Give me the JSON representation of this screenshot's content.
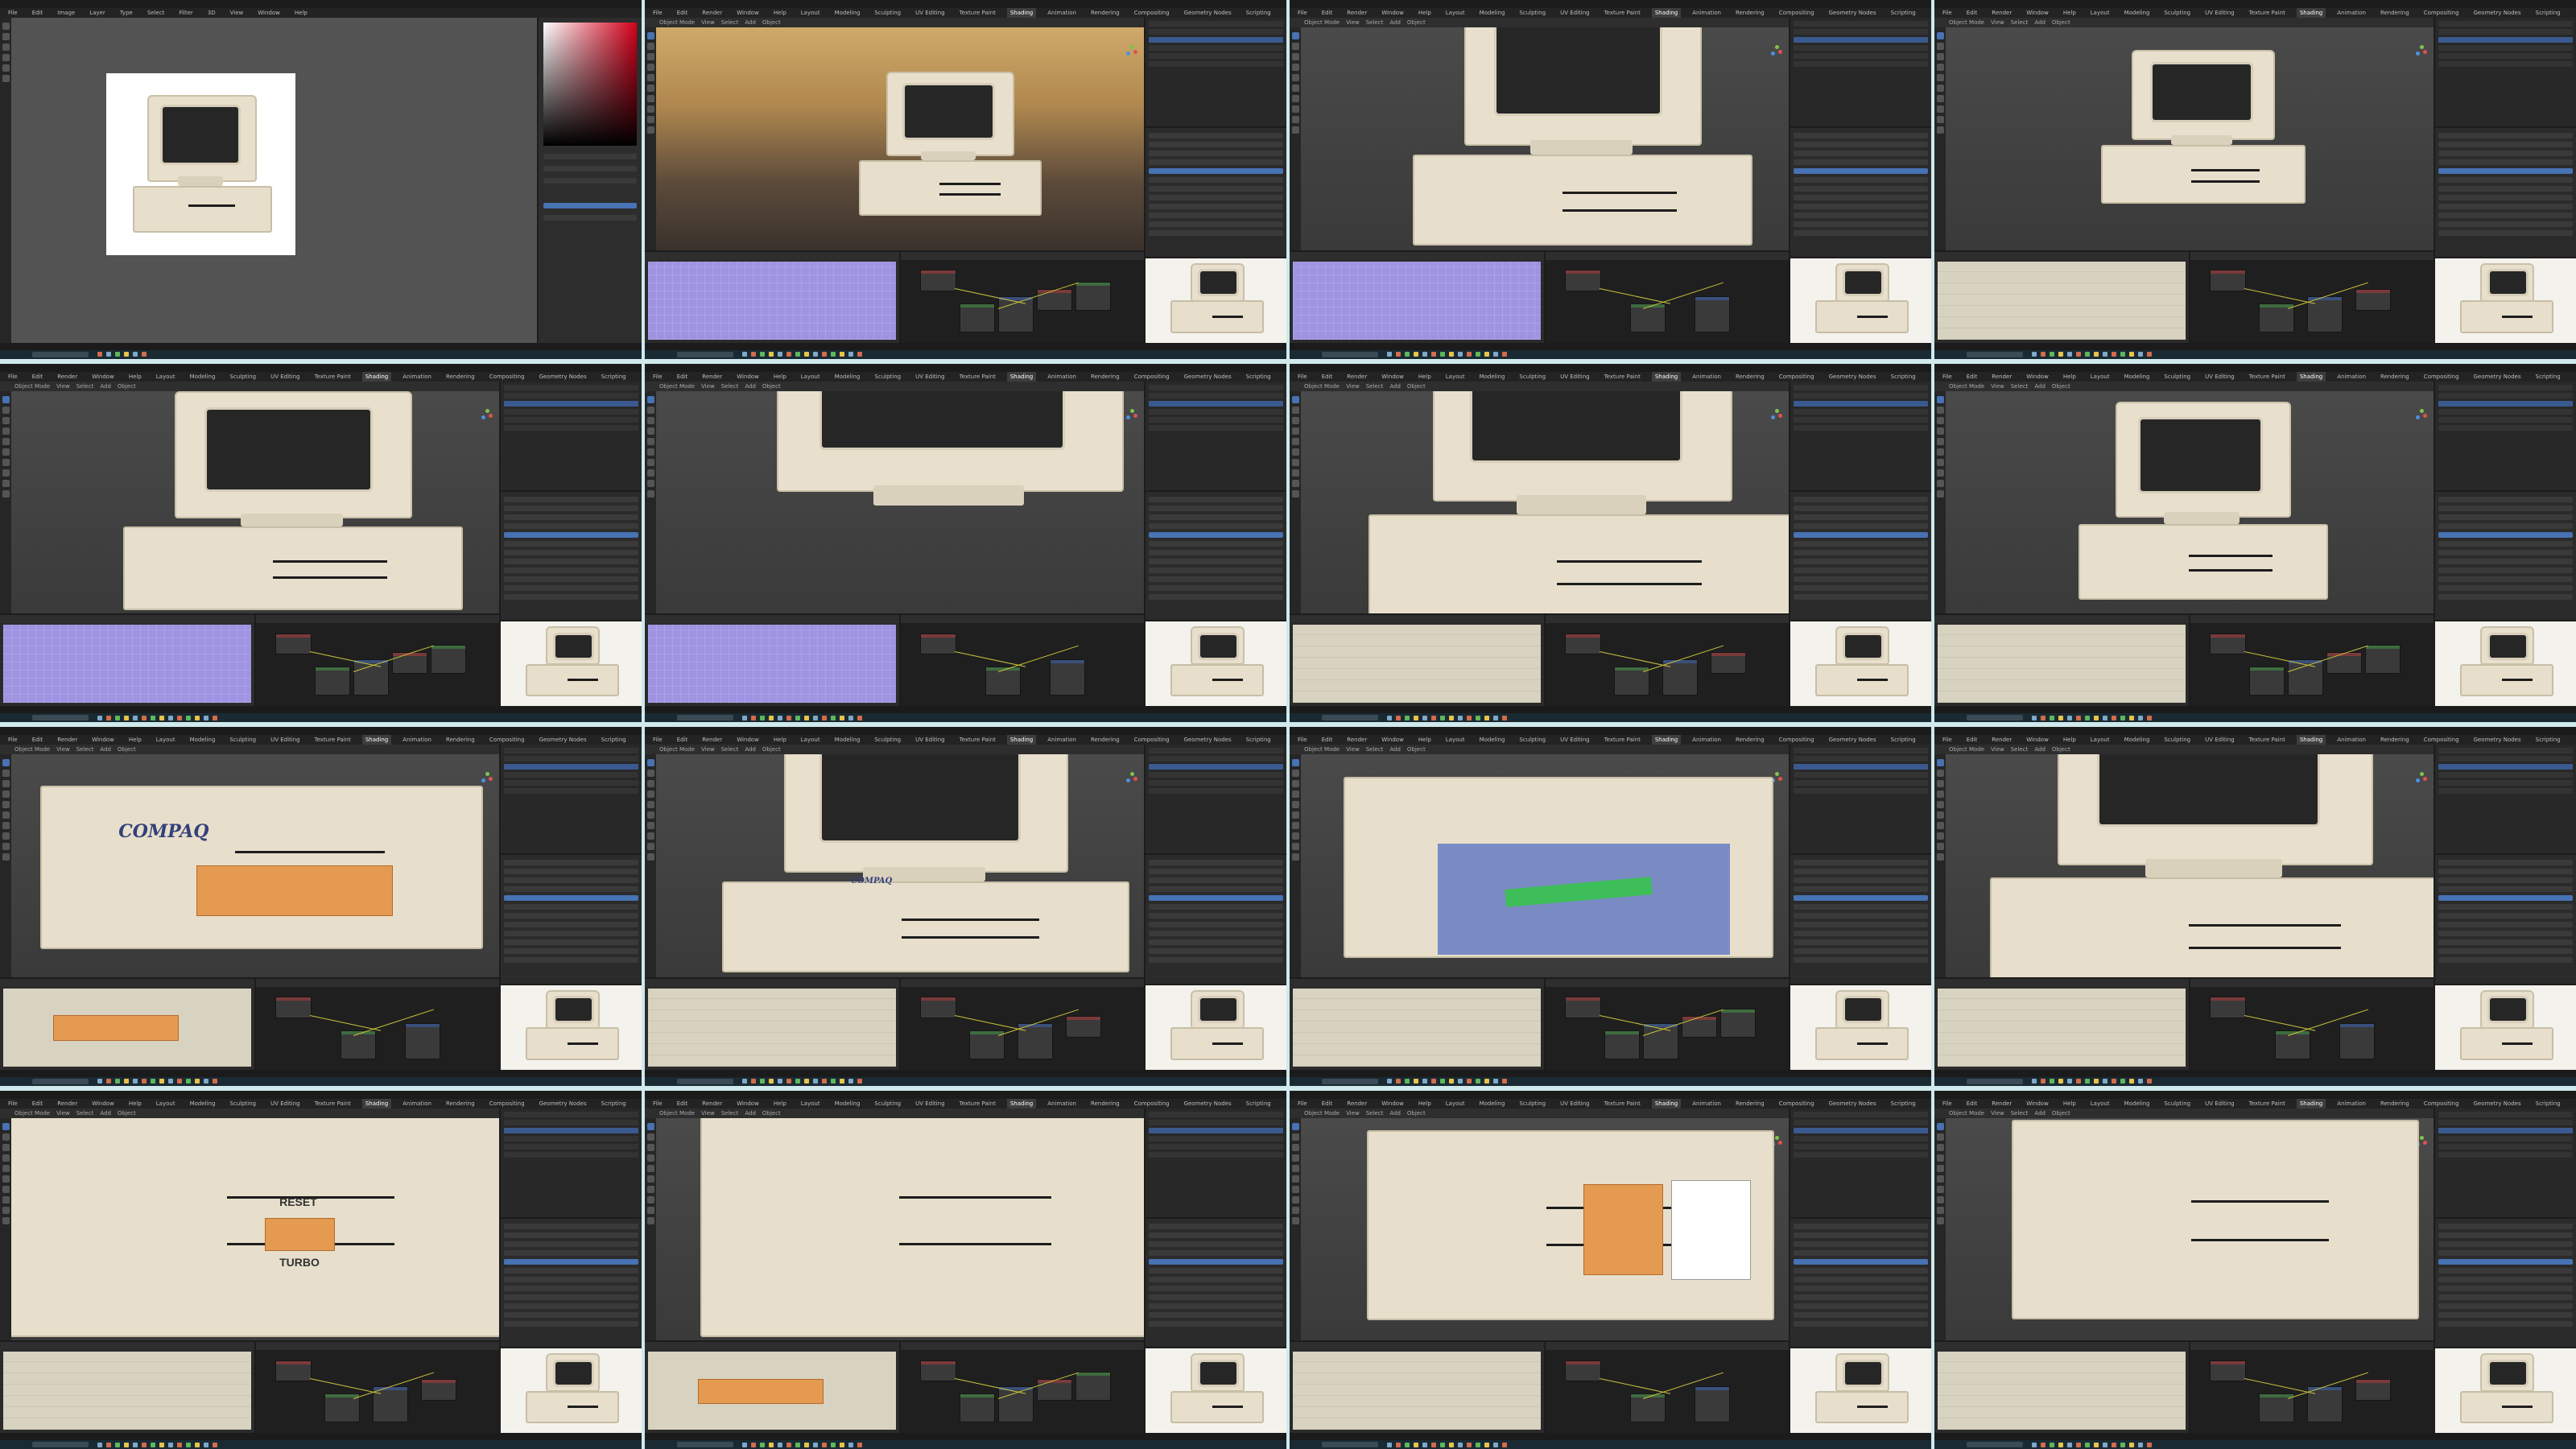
{
  "grid": {
    "rows": 4,
    "cols": 4
  },
  "colors": {
    "background": "#d8eef0",
    "blender_panel": "#2b2b2b",
    "selection_blue": "#4772b3",
    "uv_purple": "#9e94e2",
    "highlight_orange": "#e59a52",
    "plastic_beige": "#e8e0cc",
    "node_wire": "#c9c23f"
  },
  "blender": {
    "menu": [
      "File",
      "Edit",
      "Render",
      "Window",
      "Help"
    ],
    "workspaces": [
      "Layout",
      "Modeling",
      "Sculpting",
      "UV Editing",
      "Texture Paint",
      "Shading",
      "Animation",
      "Rendering",
      "Compositing",
      "Geometry Nodes",
      "Scripting"
    ],
    "active_workspace": "Shading",
    "viewport_header": [
      "Object Mode",
      "View",
      "Select",
      "Add",
      "Object"
    ]
  },
  "photoshop": {
    "menu": [
      "File",
      "Edit",
      "Image",
      "Layer",
      "Type",
      "Select",
      "Filter",
      "3D",
      "View",
      "Window",
      "Help"
    ]
  },
  "tiles": [
    {
      "id": 1,
      "app": "photoshop",
      "view": "reference-photo"
    },
    {
      "id": 2,
      "app": "blender",
      "view": "sunset-render"
    },
    {
      "id": 3,
      "app": "blender",
      "view": "base-closeup"
    },
    {
      "id": 4,
      "app": "blender",
      "view": "full-model-top"
    },
    {
      "id": 5,
      "app": "blender",
      "view": "monitor-wireframe"
    },
    {
      "id": 6,
      "app": "blender",
      "view": "monitor-closeup"
    },
    {
      "id": 7,
      "app": "blender",
      "view": "monitor-bottom"
    },
    {
      "id": 8,
      "app": "blender",
      "view": "front-ortho"
    },
    {
      "id": 9,
      "app": "blender",
      "view": "compaq-badge",
      "badge": "COMPAQ"
    },
    {
      "id": 10,
      "app": "blender",
      "view": "front-drives"
    },
    {
      "id": 11,
      "app": "blender",
      "view": "drive-bay-blue"
    },
    {
      "id": 12,
      "app": "blender",
      "view": "front-panel"
    },
    {
      "id": 13,
      "app": "blender",
      "view": "reset-turbo",
      "labels": [
        "RESET",
        "TURBO"
      ]
    },
    {
      "id": 14,
      "app": "blender",
      "view": "drive-angle"
    },
    {
      "id": 15,
      "app": "blender",
      "view": "drive-detail"
    },
    {
      "id": 16,
      "app": "blender",
      "view": "drive-wire"
    }
  ]
}
